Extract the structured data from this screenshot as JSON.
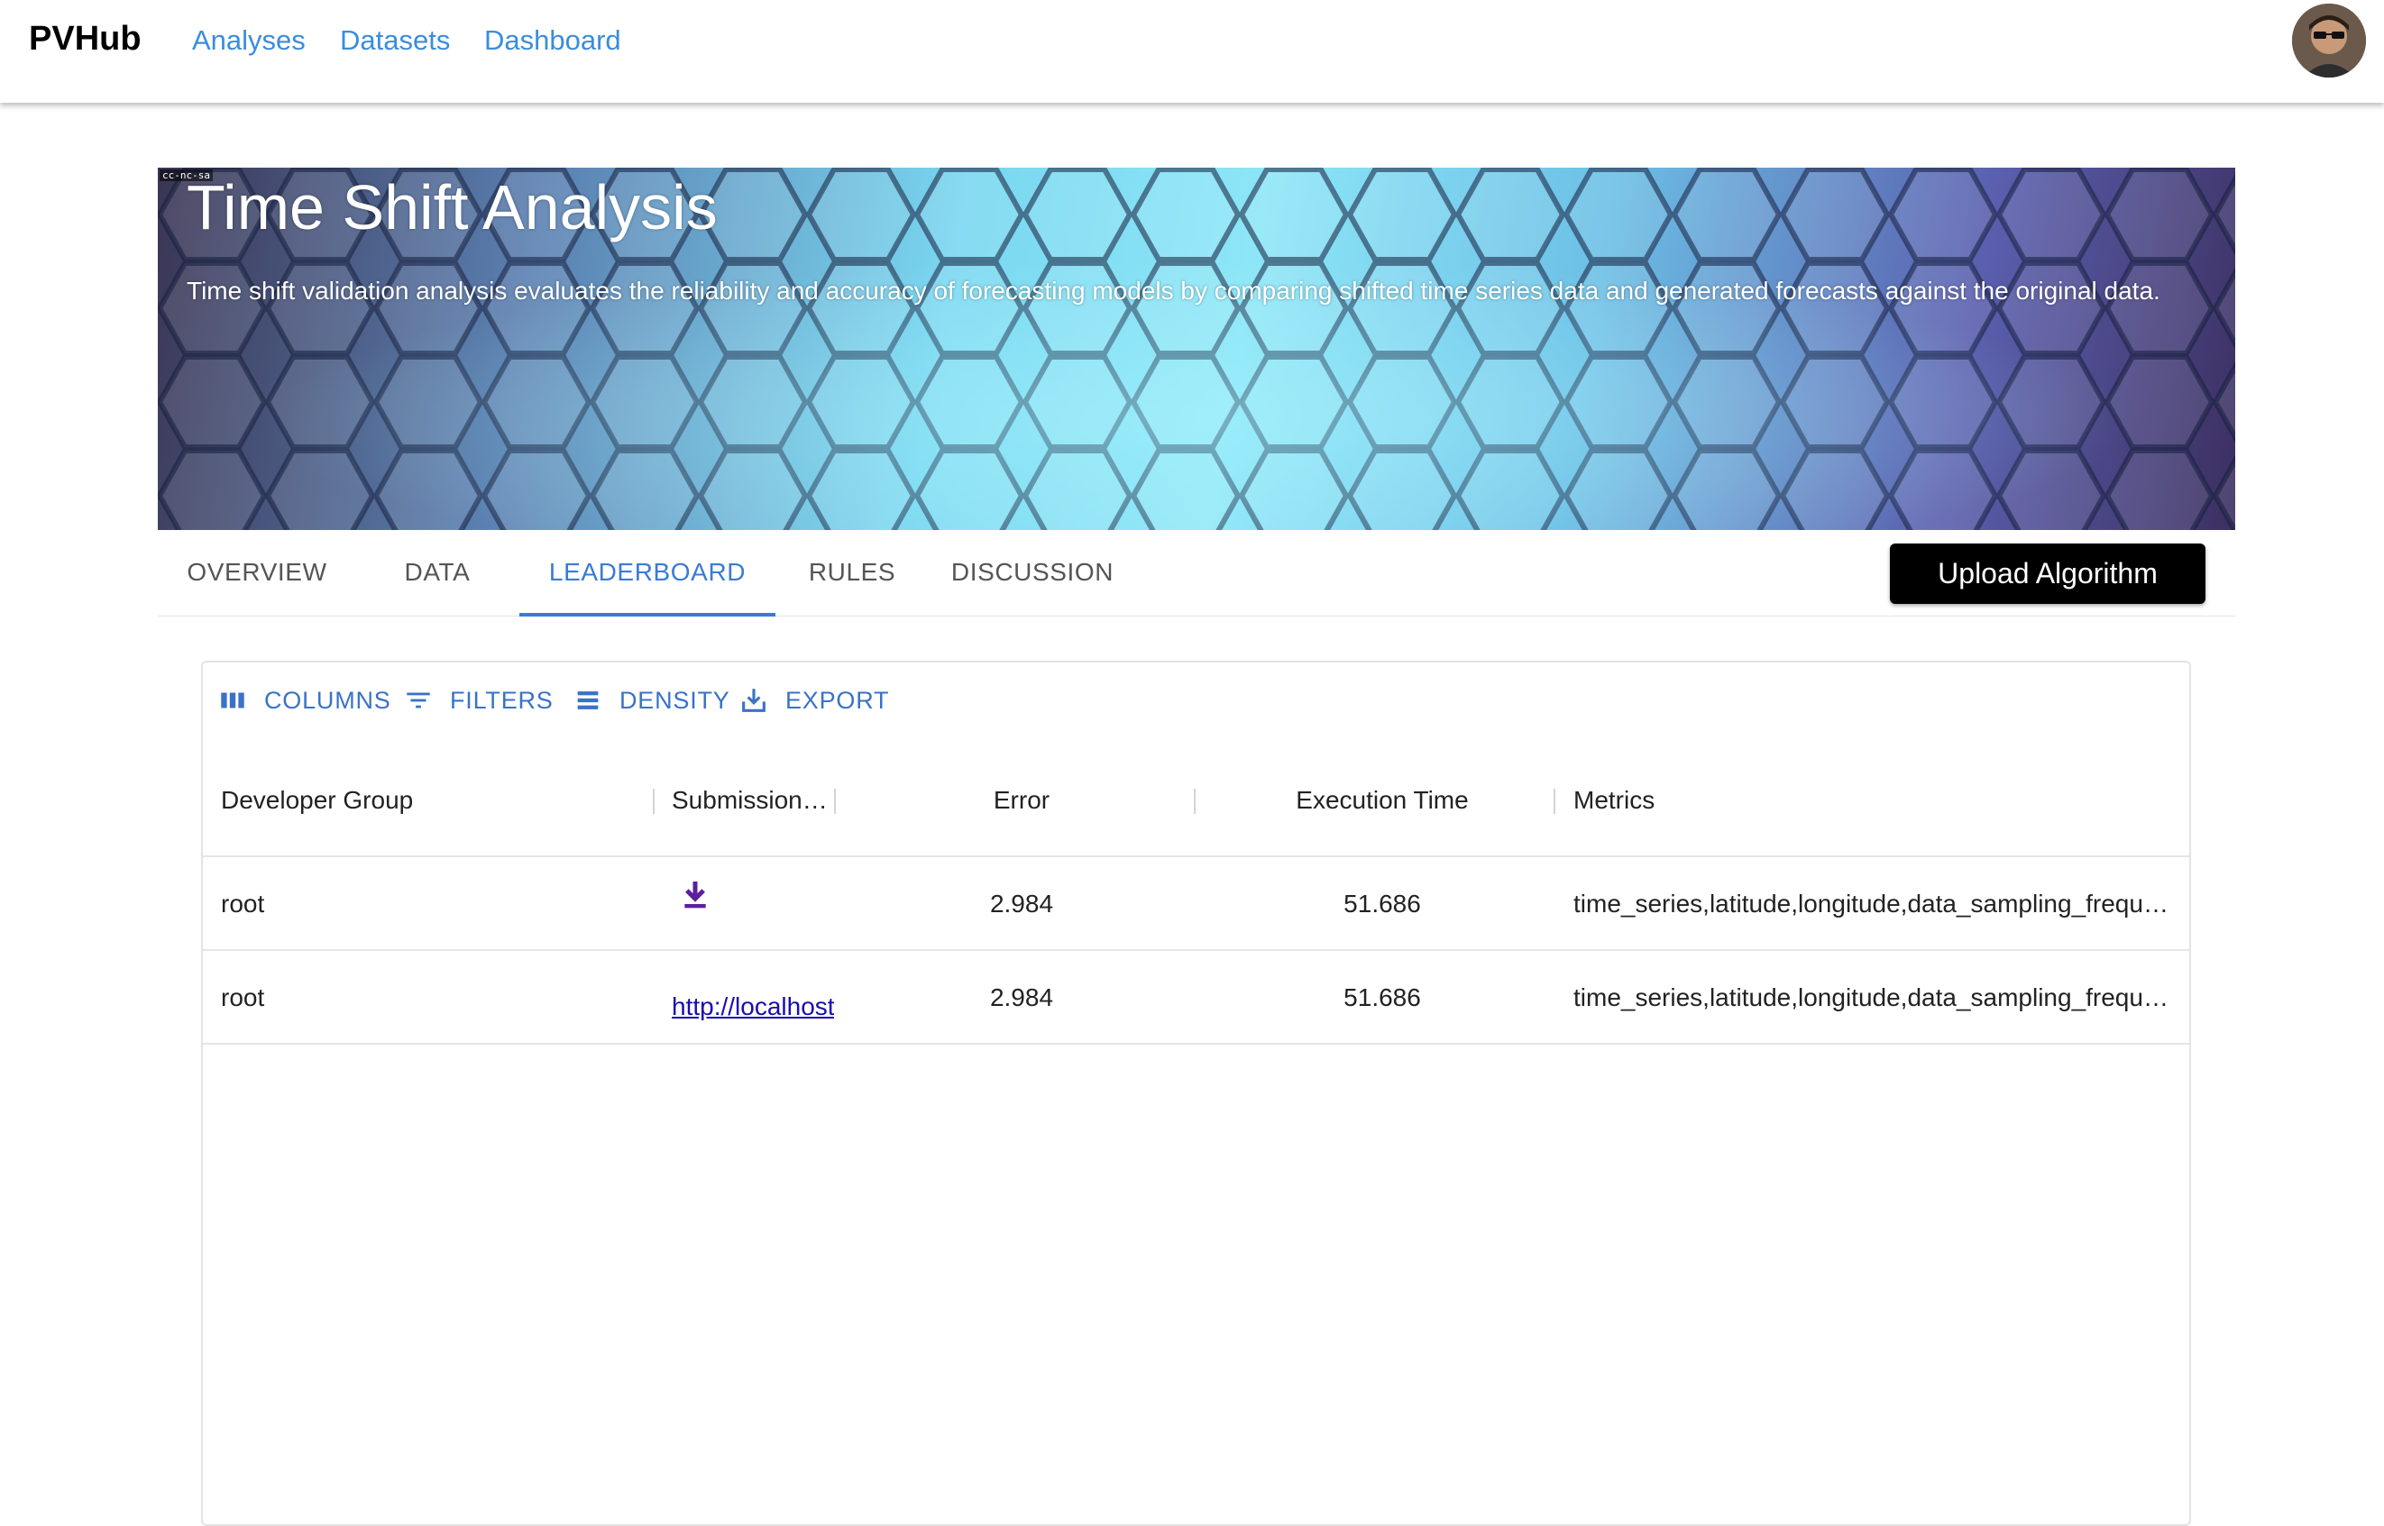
{
  "app": {
    "brand": "PVHub",
    "nav": [
      "Analyses",
      "Datasets",
      "Dashboard"
    ]
  },
  "banner": {
    "title": "Time Shift Analysis",
    "subtitle": "Time shift validation analysis evaluates the reliability and accuracy of forecasting models by comparing shifted time series data and generated forecasts against the original data.",
    "license_badge": "cc-nc-sa"
  },
  "tabs": {
    "items": [
      "OVERVIEW",
      "DATA",
      "LEADERBOARD",
      "RULES",
      "DISCUSSION"
    ],
    "active": "LEADERBOARD"
  },
  "upload_button": "Upload Algorithm",
  "toolbar": {
    "columns": "COLUMNS",
    "filters": "FILTERS",
    "density": "DENSITY",
    "export": "EXPORT"
  },
  "table": {
    "headers": [
      "Developer Group",
      "Submission…",
      "Error",
      "Execution Time",
      "Metrics"
    ],
    "rows": [
      {
        "developer_group": "root",
        "submission_icon": "download-icon",
        "error": "2.984",
        "execution_time": "51.686",
        "metrics": "time_series,latitude,longitude,data_sampling_frequ…"
      },
      {
        "developer_group": "root",
        "submission_link": "http://localhost",
        "error": "2.984",
        "execution_time": "51.686",
        "metrics": "time_series,latitude,longitude,data_sampling_frequ…"
      }
    ]
  },
  "colors": {
    "accent": "#3a7bd5",
    "nav_link": "#3a8dde",
    "download_icon": "#5b1f9e",
    "link": "#1a0dab"
  }
}
